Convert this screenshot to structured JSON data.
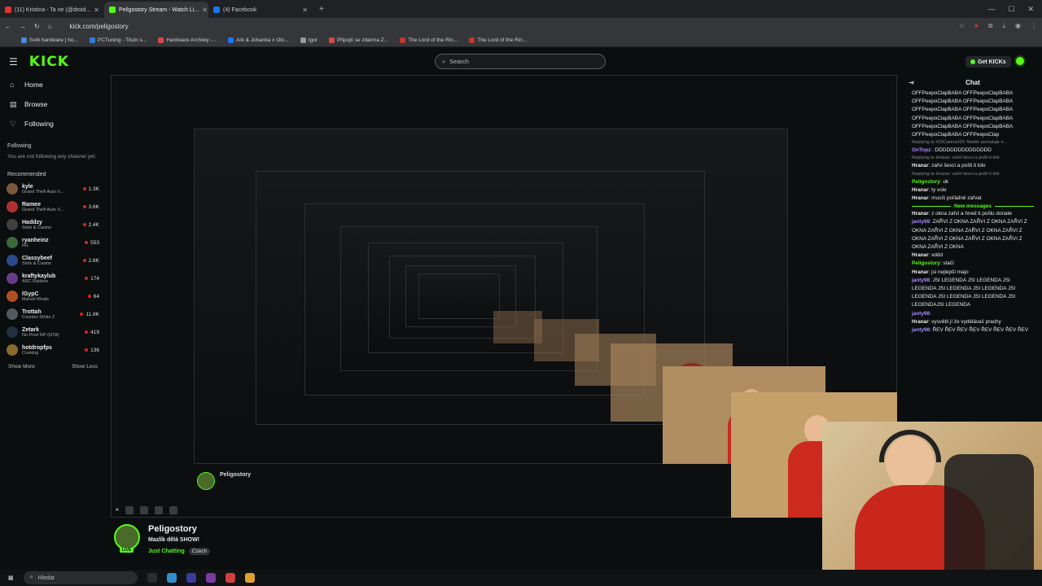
{
  "browser": {
    "tabs": [
      {
        "label": "(11) Kristina - Ta ne (@droid...",
        "color": "#e23434"
      },
      {
        "label": "Peligostory Stream - Watch Li...",
        "color": "#53fc18"
      },
      {
        "label": "(4) Facebook",
        "color": "#1877f2"
      }
    ],
    "new_tab": "+",
    "url": "kick.com/peligostory",
    "bookmarks": [
      {
        "label": "Svět hardware | ho...",
        "color": "#4a8bd6"
      },
      {
        "label": "PCTuning - Tituln s...",
        "color": "#2f7bd8"
      },
      {
        "label": "Hardware Archiwy -...",
        "color": "#d64a4a"
      },
      {
        "label": "Ark & Johanka x Olo...",
        "color": "#1877f2"
      },
      {
        "label": "Igor",
        "color": "#999999"
      },
      {
        "label": "Připojit se zdarma Z...",
        "color": "#d64a4a"
      },
      {
        "label": "The Lord of the Rin...",
        "color": "#c0392b"
      },
      {
        "label": "The Lord of the Rin...",
        "color": "#c0392b"
      }
    ]
  },
  "header": {
    "logo": "KICK",
    "search_placeholder": "Search",
    "get_kicks": "Get KICKs"
  },
  "sidebar": {
    "nav": [
      {
        "label": "Home",
        "icon": "⌂"
      },
      {
        "label": "Browse",
        "icon": "▤"
      },
      {
        "label": "Following",
        "icon": "♡"
      }
    ],
    "following_title": "Following",
    "following_note": "You are not following any channel yet.",
    "recommended_title": "Recommended",
    "recommended": [
      {
        "name": "kyle",
        "category": "Grand Theft Auto V...",
        "viewers": "1.3K",
        "color": "#7a5a3a"
      },
      {
        "name": "Ramee",
        "category": "Grand Theft Auto V...",
        "viewers": "3.6K",
        "color": "#b03030"
      },
      {
        "name": "Haddzy",
        "category": "Slots & Casino",
        "viewers": "2.4K",
        "color": "#404040"
      },
      {
        "name": "ryanheinz",
        "category": "IRL",
        "viewers": "553",
        "color": "#3a6a3a"
      },
      {
        "name": "Classybeef",
        "category": "Slots & Casino",
        "viewers": "2.6K",
        "color": "#2a4a8a"
      },
      {
        "name": "kraftykaylub",
        "category": "ARC Raiders",
        "viewers": "174",
        "color": "#6a3a8a"
      },
      {
        "name": "lGypC",
        "category": "Marvel Rivals",
        "viewers": "64",
        "color": "#b05020"
      },
      {
        "name": "Trottah",
        "category": "Counter-Strike 2",
        "viewers": "11.8K",
        "color": "#505a60"
      },
      {
        "name": "Zetark",
        "category": "No Pixel RP (GTA)",
        "viewers": "419",
        "color": "#203040"
      },
      {
        "name": "hotdropfps",
        "category": "Cooking",
        "viewers": "136",
        "color": "#8a6a2a"
      }
    ],
    "show_more": "Show More",
    "show_less": "Show Less"
  },
  "chat": {
    "title": "Chat",
    "lines": [
      {
        "type": "text",
        "text": "OFFPeepoClapBABA OFFPeepoClapBABA"
      },
      {
        "type": "text",
        "text": "OFFPeepoClapBABA OFFPeepoClapBABA"
      },
      {
        "type": "text",
        "text": "OFFPeepoClapBABA OFFPeepoClapBABA"
      },
      {
        "type": "text",
        "text": "OFFPeepoClapBABA OFFPeepoClapBABA"
      },
      {
        "type": "text",
        "text": "OFFPeepoClapBABA OFFPeepoClapBABA"
      },
      {
        "type": "text",
        "text": "OFFPeepoClapBABA OFFPeepoClap"
      },
      {
        "type": "reply",
        "text": "Replying to #20Canna420: Martin pomatuje n..."
      },
      {
        "type": "msg",
        "user": "OnTopz",
        "ucls": "v",
        "text": ":DDDDDDDDDDDDDDD"
      },
      {
        "type": "reply",
        "text": "Replying to Hranar: zařvi ševci a pošli ti kilo"
      },
      {
        "type": "msg",
        "user": "Hranar",
        "ucls": "w",
        "text": "zařvi ševci a pošli ti kilo"
      },
      {
        "type": "reply",
        "text": "Replying to Hranar: zařvi ševci a pošli ti kilo"
      },
      {
        "type": "msg",
        "user": "Peligostory",
        "ucls": "u",
        "text": "ok"
      },
      {
        "type": "msg",
        "user": "Hranar",
        "ucls": "w",
        "text": "ty vole"
      },
      {
        "type": "msg",
        "user": "Hranar",
        "ucls": "w",
        "text": "musíš pořádně zařvat"
      },
      {
        "type": "divider",
        "text": "New messages"
      },
      {
        "type": "msg",
        "user": "Hranar",
        "ucls": "w",
        "text": "z okna zařvi a hned ti pošlu donate"
      },
      {
        "type": "msg",
        "user": "janty98",
        "ucls": "v",
        "text": "ZAŘVI Z OKNA ZAŘVI Z OKNA ZAŘVI Z OKNA ZAŘVI Z OKNA ZAŘVI Z OKNA ZAŘVI Z OKNA ZAŘVI Z OKNA ZAŘVI Z OKNA ZAŘVI Z OKNA ZAŘVI Z OKNA"
      },
      {
        "type": "msg",
        "user": "Hranar",
        "ucls": "w",
        "text": "xddd"
      },
      {
        "type": "msg",
        "user": "Peligostory",
        "ucls": "u",
        "text": "stačí"
      },
      {
        "type": "msg",
        "user": "Hranar",
        "ucls": "w",
        "text": "jsi nejlepší majo"
      },
      {
        "type": "msg",
        "user": "janty98",
        "ucls": "v",
        "text": "JSI LEGENDA JSI LEGENDA JSI LEGENDA JSI LEGENDA JSI LEGENDA JSI LEGENDA JSI LEGENDA JSI LEGENDA JSI LEGENDAJSI LEGENDA"
      },
      {
        "type": "msg",
        "user": "janty98",
        "ucls": "v",
        "text": ""
      },
      {
        "type": "msg",
        "user": "Hranar",
        "ucls": "w",
        "text": "vysvětli jí že vydělávaš prachy"
      },
      {
        "type": "msg",
        "user": "janty98",
        "ucls": "v",
        "text": "ŘEV ŘEV ŘEV ŘEV ŘEV ŘEV ŘEV ŘEV"
      }
    ]
  },
  "stream": {
    "channel": "Peligostory",
    "title": "Mazlík dělá SHOW!",
    "category": "Just Chatting",
    "language": "Czech",
    "live_badge": "LIVE"
  },
  "taskbar": {
    "search_placeholder": "Hledat"
  }
}
